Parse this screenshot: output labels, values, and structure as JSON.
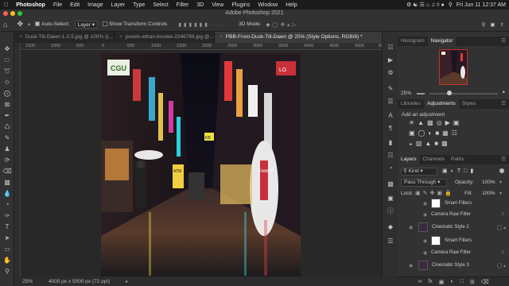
{
  "menubar": {
    "apple_icon": "apple-icon",
    "app_name": "Photoshop",
    "items": [
      "File",
      "Edit",
      "Image",
      "Layer",
      "Type",
      "Select",
      "Filter",
      "3D",
      "View",
      "Plugins",
      "Window",
      "Help"
    ],
    "clock": "Fri Jun 11  12:37 AM"
  },
  "window": {
    "title": "Adobe Photoshop 2021"
  },
  "options_bar": {
    "auto_select_label": "Auto-Select:",
    "auto_select_value": "Layer",
    "transform_label": "Show Transform Controls",
    "mode_label": "3D Mode:"
  },
  "tabs": [
    {
      "label": "Dusk-Till-Dawn-1-2-5.jpg @ 100% (L..."
    },
    {
      "label": "pexels-ethan-brooke-2246789.jpg @..."
    },
    {
      "label": "PBB-From-Dusk-Till-Dawn @ 25% (Style Options, RGB/8) *"
    }
  ],
  "ruler": {
    "marks": [
      "1500",
      "1000",
      "500",
      "0",
      "500",
      "1000",
      "1500",
      "2000",
      "2500",
      "3000",
      "3500",
      "4000",
      "4500",
      "5000",
      "5500"
    ]
  },
  "photo_signs": [
    "CGU",
    "ATM",
    "KB",
    "FAMILY",
    "LG"
  ],
  "status": {
    "zoom": "25%",
    "doc_info": "4000 px x 5000 px (72 ppi)"
  },
  "navigator": {
    "tabs": [
      "Histogram",
      "Navigator"
    ],
    "zoom": "25%"
  },
  "adjustments": {
    "tabs": [
      "Libraries",
      "Adjustments",
      "Styles"
    ],
    "heading": "Add an adjustment"
  },
  "layers": {
    "tabs": [
      "Layers",
      "Channels",
      "Paths"
    ],
    "kind_label": "Kind",
    "blend_mode": "Pass Through",
    "opacity_label": "Opacity:",
    "opacity_value": "100%",
    "lock_label": "Lock:",
    "fill_label": "Fill:",
    "fill_value": "100%",
    "items": [
      {
        "name": "Smart Filters",
        "kind": "filters"
      },
      {
        "name": "Camera Raw Filter",
        "kind": "filter"
      },
      {
        "name": "Cinematic Style 2",
        "kind": "layer"
      },
      {
        "name": "Smart Filters",
        "kind": "filters"
      },
      {
        "name": "Camera Raw Filter",
        "kind": "filter"
      },
      {
        "name": "Cinematic Style 3",
        "kind": "layer"
      }
    ],
    "bottom_icons": [
      "fx"
    ]
  },
  "colors": {
    "accent": "#e8e8e8",
    "panel": "#323232",
    "dark": "#262626"
  }
}
